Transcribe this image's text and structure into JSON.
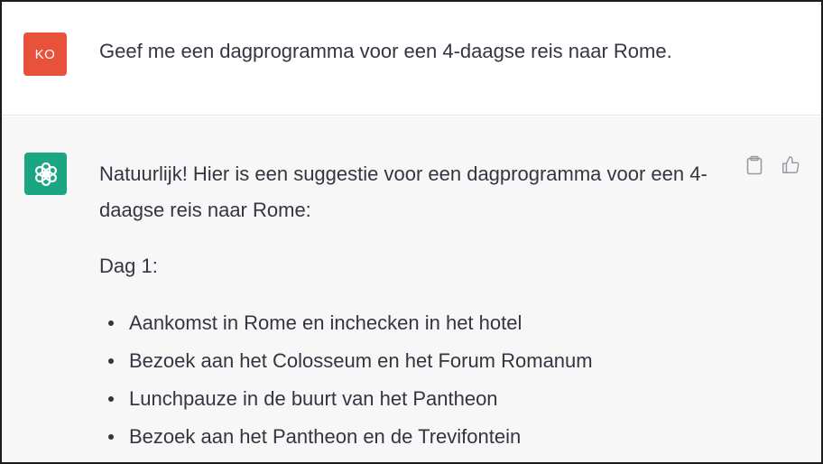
{
  "user_message": {
    "avatar_initials": "KO",
    "text": "Geef me een dagprogramma voor een 4-daagse reis naar Rome."
  },
  "assistant_message": {
    "avatar_icon": "openai-logo-icon",
    "intro": "Natuurlijk! Hier is een suggestie voor een dagprogramma voor een 4-daagse reis naar Rome:",
    "day_heading": "Dag 1:",
    "items": [
      "Aankomst in Rome en inchecken in het hotel",
      "Bezoek aan het Colosseum en het Forum Romanum",
      "Lunchpauze in de buurt van het Pantheon",
      "Bezoek aan het Pantheon en de Trevifontein"
    ],
    "actions": [
      "clipboard-icon",
      "thumbs-up-icon"
    ]
  },
  "colors": {
    "user_avatar": "#e8513a",
    "assistant_avatar": "#1ba683",
    "assistant_bg": "#f7f7f8",
    "text": "#343541"
  }
}
